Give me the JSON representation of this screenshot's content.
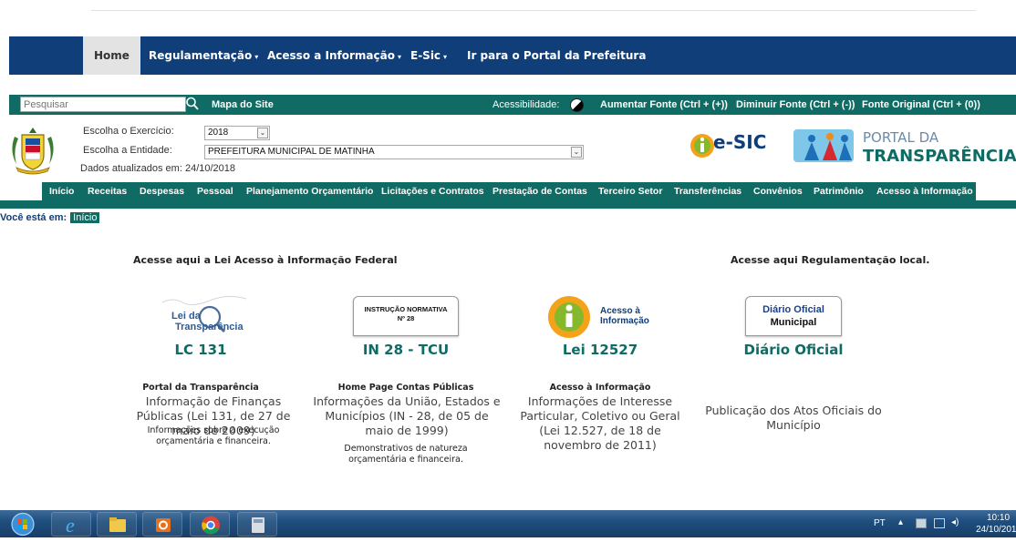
{
  "nav": {
    "home": "Home",
    "regulamentacao": "Regulamentação",
    "acesso": "Acesso a Informação",
    "esic": "E-Sic",
    "portal": "Ir para o Portal da Prefeitura",
    "caret": "▾"
  },
  "toolbar": {
    "search_placeholder": "Pesquisar",
    "mapa": "Mapa do Site",
    "acessibilidade": "Acessibilidade:",
    "aumentar": "Aumentar Fonte (Ctrl + (+))",
    "diminuir": "Diminuir Fonte (Ctrl + (-))",
    "original": "Fonte Original (Ctrl + (0))"
  },
  "header": {
    "exercicio_label": "Escolha o Exercício:",
    "exercicio_value": "2018",
    "entidade_label": "Escolha a Entidade:",
    "entidade_value": "PREFEITURA MUNICIPAL DE MATINHA",
    "atualizados": "Dados atualizados em: 24/10/2018",
    "esic_logo": "e-SIC",
    "portal_line1": "PORTAL DA",
    "portal_line2": "TRANSPARÊNCIA"
  },
  "menu": [
    "Início",
    "Receitas",
    "Despesas",
    "Pessoal",
    "Planejamento Orçamentário",
    "Licitações e Contratos",
    "Prestação de Contas",
    "Terceiro Setor",
    "Transferências",
    "Convênios",
    "Patrimônio",
    "Acesso à Informação"
  ],
  "breadcrumb": {
    "label": "Você está em:",
    "current": "Início"
  },
  "lead": {
    "federal": "Acesse aqui a Lei Acesso à Informação Federal",
    "local": "Acesse aqui Regulamentação local."
  },
  "cards": [
    {
      "img_text": [
        "Lei da",
        "Transparência"
      ],
      "title": "LC 131",
      "sub": "Portal da Transparência",
      "desc": "Informação de Finanças Públicas (Lei 131, de 27 de maio de 2009)",
      "note": "Informações sobre a execução orçamentária e financeira."
    },
    {
      "img_text": [
        "INSTRUÇÃO NORMATIVA",
        "Nº 28"
      ],
      "title": "IN 28 - TCU",
      "sub": "Home Page Contas Públicas",
      "desc": "Informações da União, Estados e Municípios (IN - 28, de 05 de maio de 1999)",
      "note": "Demonstrativos de natureza orçamentária e financeira."
    },
    {
      "img_text": [
        "Acesso à",
        "Informação"
      ],
      "title": "Lei 12527",
      "sub": "Acesso à Informação",
      "desc": "Informações de Interesse Particular, Coletivo ou Geral (Lei 12.527, de 18 de novembro de 2011)",
      "note": ""
    },
    {
      "img_text": [
        "Diário Oficial",
        "Municipal"
      ],
      "title": "Diário Oficial",
      "sub": "",
      "desc": "Publicação dos Atos Oficiais do Município",
      "note": ""
    }
  ],
  "taskbar": {
    "lang": "PT",
    "time": "10:10",
    "date": "24/10/201"
  },
  "colors": {
    "navy": "#0f3e79",
    "teal": "#0f6b63",
    "accent_orange": "#f5a21b"
  }
}
